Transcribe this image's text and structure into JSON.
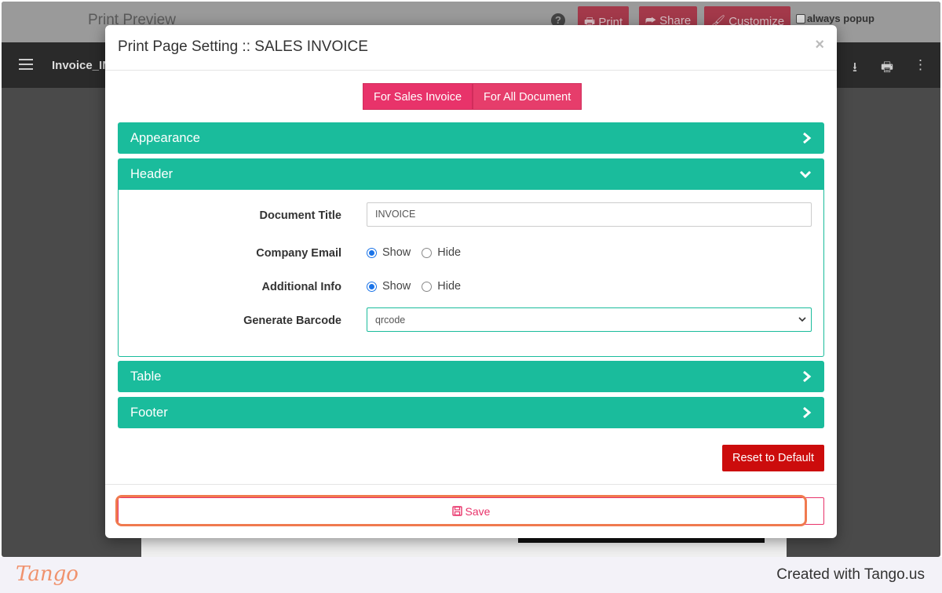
{
  "background": {
    "title": "Print Preview",
    "help_icon": "?",
    "buttons": [
      {
        "label": "Print",
        "icon": "print-icon"
      },
      {
        "label": "Share",
        "icon": "share-icon"
      },
      {
        "label": "Customize",
        "icon": "brush-icon"
      }
    ],
    "always_popup_label": "always popup",
    "filename": "Invoice_IN"
  },
  "modal": {
    "title": "Print Page Setting :: SALES INVOICE",
    "close": "×",
    "tabs": [
      {
        "label": "For Sales Invoice"
      },
      {
        "label": "For All Document"
      }
    ],
    "sections": {
      "appearance": "Appearance",
      "header": "Header",
      "table": "Table",
      "footer": "Footer"
    },
    "header_fields": {
      "document_title_label": "Document Title",
      "document_title_value": "INVOICE",
      "company_email_label": "Company Email",
      "additional_info_label": "Additional Info",
      "show": "Show",
      "hide": "Hide",
      "company_email_selected": "Show",
      "additional_info_selected": "Show",
      "generate_barcode_label": "Generate Barcode",
      "generate_barcode_value": "qrcode"
    },
    "reset_label": "Reset to Default",
    "save_label": "Save"
  },
  "tango": {
    "logo": "Tango",
    "credit": "Created with Tango.us"
  },
  "colors": {
    "accent": "#1abc9c",
    "pink": "#e8336a",
    "danger": "#cc0c0c",
    "highlight": "#f07a4f"
  }
}
